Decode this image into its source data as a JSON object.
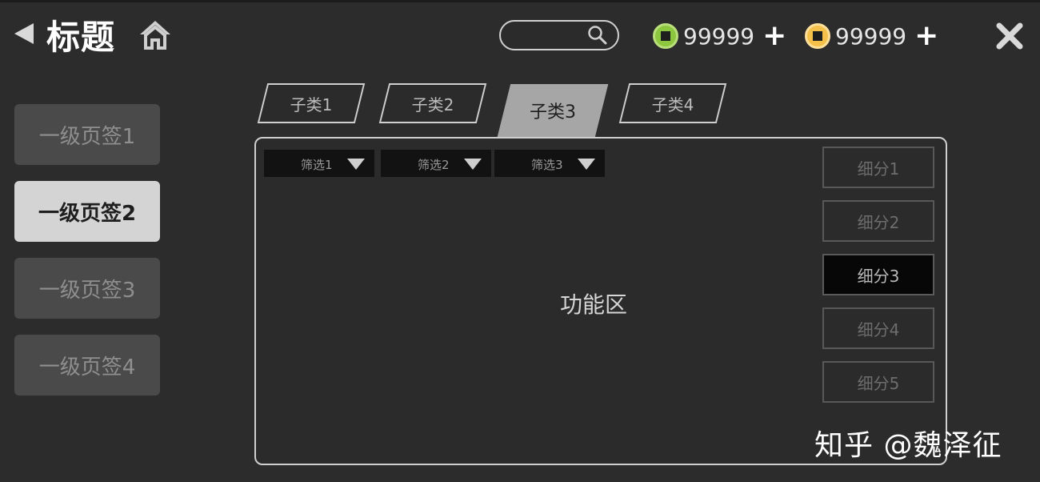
{
  "header": {
    "title": "标题",
    "search_placeholder": "",
    "currencies": [
      {
        "icon": "green-coin-icon",
        "color": "#8dc63f",
        "value": "99999"
      },
      {
        "icon": "gold-coin-icon",
        "color": "#f5c04a",
        "value": "99999"
      }
    ],
    "plus_label": "+"
  },
  "sidebar": {
    "tabs": [
      {
        "label": "一级页签1",
        "active": false
      },
      {
        "label": "一级页签2",
        "active": true
      },
      {
        "label": "一级页签3",
        "active": false
      },
      {
        "label": "一级页签4",
        "active": false
      }
    ]
  },
  "subtabs": [
    {
      "label": "子类1",
      "active": false
    },
    {
      "label": "子类2",
      "active": false
    },
    {
      "label": "子类3",
      "active": true
    },
    {
      "label": "子类4",
      "active": false
    }
  ],
  "filters": [
    {
      "label": "筛选1"
    },
    {
      "label": "筛选2"
    },
    {
      "label": "筛选3"
    }
  ],
  "main": {
    "function_area_label": "功能区"
  },
  "segments": [
    {
      "label": "细分1",
      "active": false
    },
    {
      "label": "细分2",
      "active": false
    },
    {
      "label": "细分3",
      "active": true
    },
    {
      "label": "细分4",
      "active": false
    },
    {
      "label": "细分5",
      "active": false
    }
  ],
  "watermark": "知乎 @魏泽征",
  "colors": {
    "background": "#2c2c2c",
    "active_side_tab": "#d4d4d4",
    "active_sub_tab": "#a6a6a6",
    "active_segment": "#070707"
  }
}
